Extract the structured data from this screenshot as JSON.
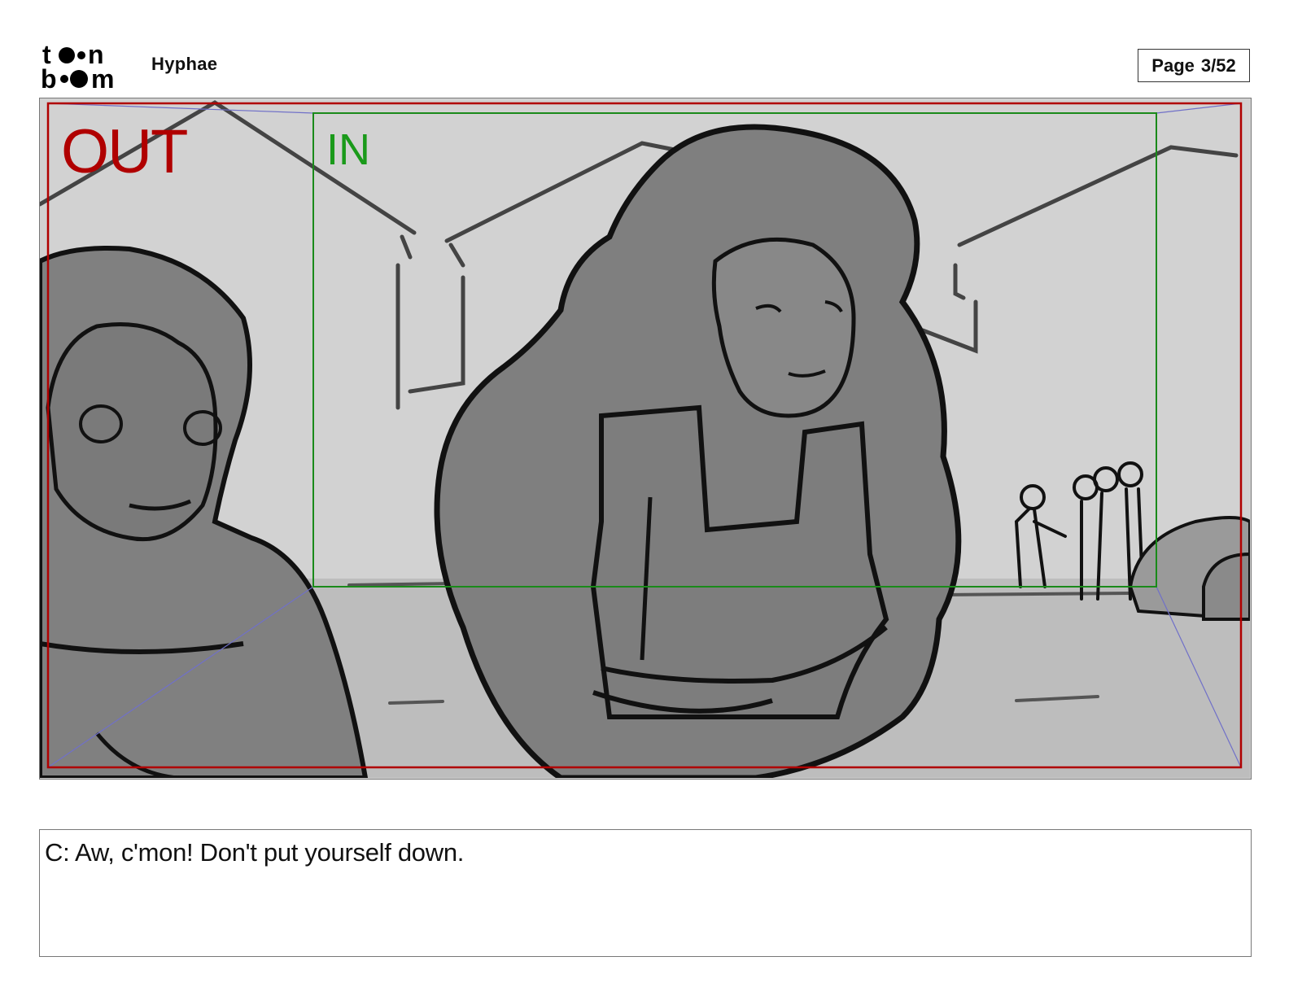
{
  "header": {
    "logo_text": "toon boom",
    "project_title": "Hyphae",
    "page_label": "Page",
    "page_number": "3/52"
  },
  "panel": {
    "out_label": "OUT",
    "in_label": "IN",
    "colors": {
      "out_frame": "#b00000",
      "in_frame": "#1a8a1a",
      "background": "#d2d2d2",
      "character_fill": "#808080"
    }
  },
  "caption": {
    "text": "C: Aw, c'mon! Don't put yourself down."
  }
}
